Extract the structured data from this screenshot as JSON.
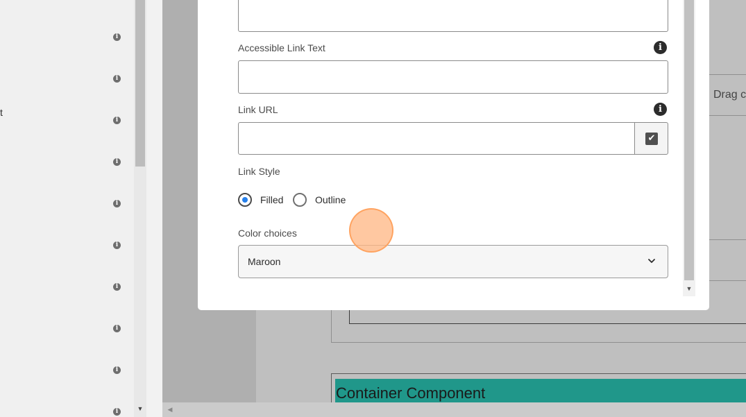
{
  "left_panel": {
    "partial_label": "t",
    "info_icon_glyph": "i"
  },
  "background": {
    "drag_label": "Drag co",
    "container_title": "Container Component"
  },
  "dialog": {
    "fields": {
      "accessible_link_text": {
        "label": "Accessible Link Text",
        "value": ""
      },
      "link_url": {
        "label": "Link URL",
        "value": ""
      }
    },
    "help_icon_glyph": "i",
    "picker_icon_glyph": "✔",
    "link_style": {
      "label": "Link Style",
      "options": [
        {
          "label": "Filled",
          "selected": true
        },
        {
          "label": "Outline",
          "selected": false
        }
      ]
    },
    "color_choices": {
      "label": "Color choices",
      "value": "Maroon"
    }
  },
  "scroll": {
    "down_arrow": "▼",
    "left_arrow": "◀"
  },
  "colors": {
    "container_bg": "#20978a",
    "radio_selected": "#2680eb",
    "cursor_highlight": "#ffb682"
  }
}
